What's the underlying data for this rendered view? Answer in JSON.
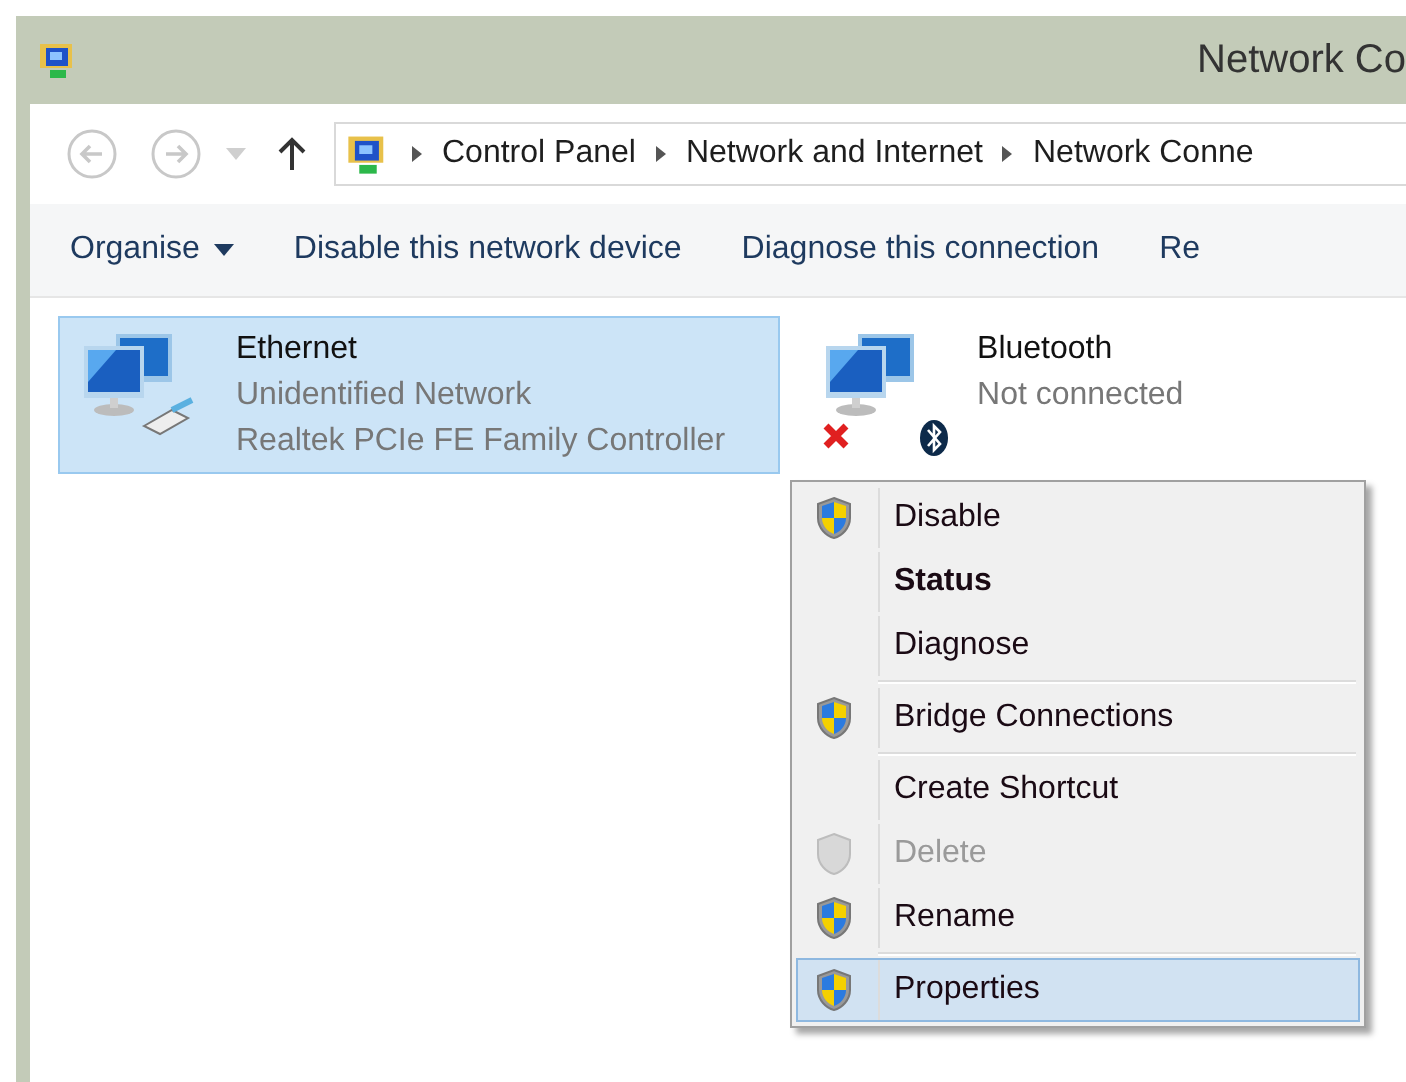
{
  "window": {
    "title": "Network Co"
  },
  "address_bar": {
    "crumbs": [
      "Control Panel",
      "Network and Internet",
      "Network Conne"
    ]
  },
  "toolbar": [
    {
      "label": "Organise",
      "dropdown": true
    },
    {
      "label": "Disable this network device",
      "dropdown": false
    },
    {
      "label": "Diagnose this connection",
      "dropdown": false
    },
    {
      "label": "Re",
      "dropdown": false
    }
  ],
  "adapters": [
    {
      "name": "Ethernet",
      "status": "Unidentified Network",
      "device": "Realtek PCIe FE Family Controller",
      "selected": true,
      "kind": "cable",
      "disconnected": false
    },
    {
      "name": "Bluetooth",
      "status": "Not connected",
      "selected": false,
      "kind": "bluetooth",
      "disconnected": true
    }
  ],
  "context_menu": [
    {
      "label": "Disable",
      "shield": true,
      "bold": false,
      "disabled": false,
      "selected": false,
      "separator_before": false
    },
    {
      "label": "Status",
      "shield": false,
      "bold": true,
      "disabled": false,
      "selected": false,
      "separator_before": false
    },
    {
      "label": "Diagnose",
      "shield": false,
      "bold": false,
      "disabled": false,
      "selected": false,
      "separator_before": false
    },
    {
      "label": "Bridge Connections",
      "shield": true,
      "bold": false,
      "disabled": false,
      "selected": false,
      "separator_before": true
    },
    {
      "label": "Create Shortcut",
      "shield": false,
      "bold": false,
      "disabled": false,
      "selected": false,
      "separator_before": true
    },
    {
      "label": "Delete",
      "shield": true,
      "bold": false,
      "disabled": true,
      "selected": false,
      "separator_before": false
    },
    {
      "label": "Rename",
      "shield": true,
      "bold": false,
      "disabled": false,
      "selected": false,
      "separator_before": false
    },
    {
      "label": "Properties",
      "shield": true,
      "bold": false,
      "disabled": false,
      "selected": true,
      "separator_before": true
    }
  ]
}
